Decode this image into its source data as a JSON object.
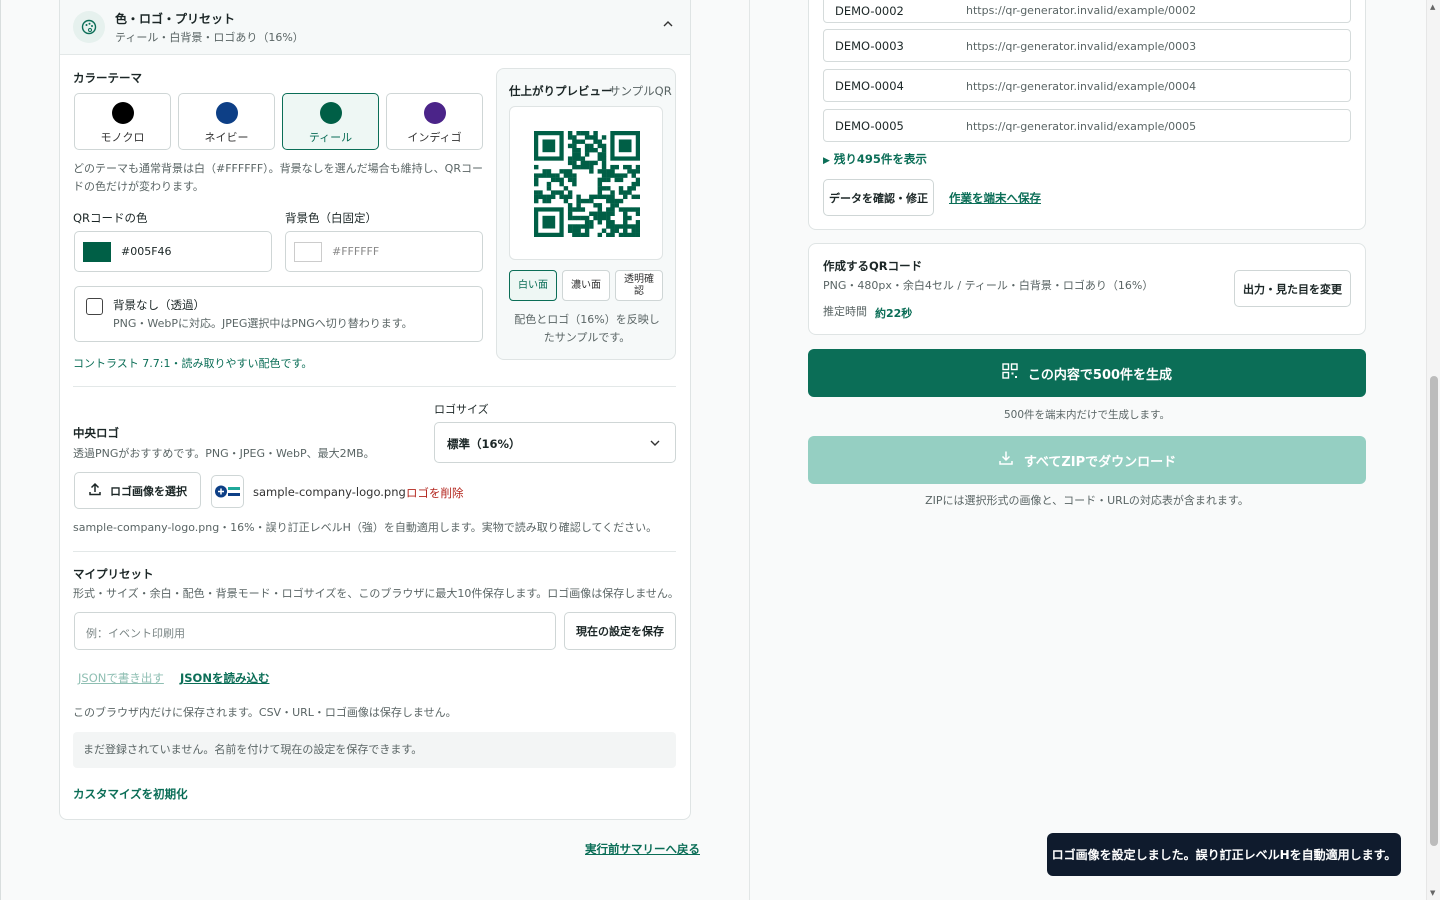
{
  "section": {
    "title": "色・ロゴ・プリセット",
    "subtitle": "ティール・白背景・ロゴあり（16%）"
  },
  "color_theme": {
    "label": "カラーテーマ",
    "options": [
      {
        "name": "モノクロ",
        "color": "#000000"
      },
      {
        "name": "ネイビー",
        "color": "#0d3f86"
      },
      {
        "name": "ティール",
        "color": "#005F46",
        "selected": true
      },
      {
        "name": "インディゴ",
        "color": "#4b2489"
      }
    ],
    "note": "どのテーマも通常背景は白（#FFFFFF）。背景なしを選んだ場合も維持し、QRコードの色だけが変わります。"
  },
  "qr_color": {
    "label": "QRコードの色",
    "value": "#005F46"
  },
  "bg_color": {
    "label": "背景色（白固定）",
    "value": "#FFFFFF"
  },
  "transparent": {
    "label": "背景なし（透過）",
    "note": "PNG・WebPに対応。JPEG選択中はPNGへ切り替わります。"
  },
  "contrast_note": "コントラスト 7.7:1・読み取りやすい配色です。",
  "preview": {
    "title": "仕上がりプレビュー",
    "tag": "サンプルQR",
    "modes": [
      "白い面",
      "濃い面",
      "透明確認"
    ],
    "note": "配色とロゴ（16%）を反映したサンプルです。"
  },
  "logo": {
    "title": "中央ロゴ",
    "note": "透過PNGがおすすめです。PNG・JPEG・WebP、最大2MB。",
    "size_label": "ロゴサイズ",
    "size_value": "標準（16%）",
    "select_button": "ロゴ画像を選択",
    "file_name": "sample-company-logo.png",
    "remove": "ロゴを削除",
    "applied_note": "sample-company-logo.png・16%・誤り訂正レベルH（強）を自動適用します。実物で読み取り確認してください。"
  },
  "presets": {
    "title": "マイプリセット",
    "note": "形式・サイズ・余白・配色・背景モード・ロゴサイズを、このブラウザに最大10件保存します。ロゴ画像は保存しません。",
    "placeholder": "例：イベント印刷用",
    "save_button": "現在の設定を保存",
    "export_json": "JSONで書き出す",
    "import_json": "JSONを読み込む",
    "storage_note": "このブラウザ内だけに保存されます。CSV・URL・ロゴ画像は保存しません。",
    "empty": "まだ登録されていません。名前を付けて現在の設定を保存できます。",
    "reset": "カスタマイズを初期化"
  },
  "back_link": "実行前サマリーへ戻る",
  "data_rows": [
    {
      "code": "DEMO-0002",
      "url": "https://qr-generator.invalid/example/0002"
    },
    {
      "code": "DEMO-0003",
      "url": "https://qr-generator.invalid/example/0003"
    },
    {
      "code": "DEMO-0004",
      "url": "https://qr-generator.invalid/example/0004"
    },
    {
      "code": "DEMO-0005",
      "url": "https://qr-generator.invalid/example/0005"
    }
  ],
  "show_more": "残り495件を表示",
  "check_button": "データを確認・修正",
  "save_work": "作業を端末へ保存",
  "summary": {
    "title": "作成するQRコード",
    "detail": "PNG・480px・余白4セル / ティール・白背景・ロゴあり（16%）",
    "time_label": "推定時間",
    "time_value": "約22秒",
    "change_button": "出力・見た目を変更"
  },
  "generate_button": "この内容で500件を生成",
  "generate_note": "500件を端末内だけで生成します。",
  "zip_button": "すべてZIPでダウンロード",
  "zip_note": "ZIPには選択形式の画像と、コード・URLの対応表が含まれます。",
  "toast": "ロゴ画像を設定しました。誤り訂正レベルHを自動適用します。",
  "accent": "#0b6e57"
}
